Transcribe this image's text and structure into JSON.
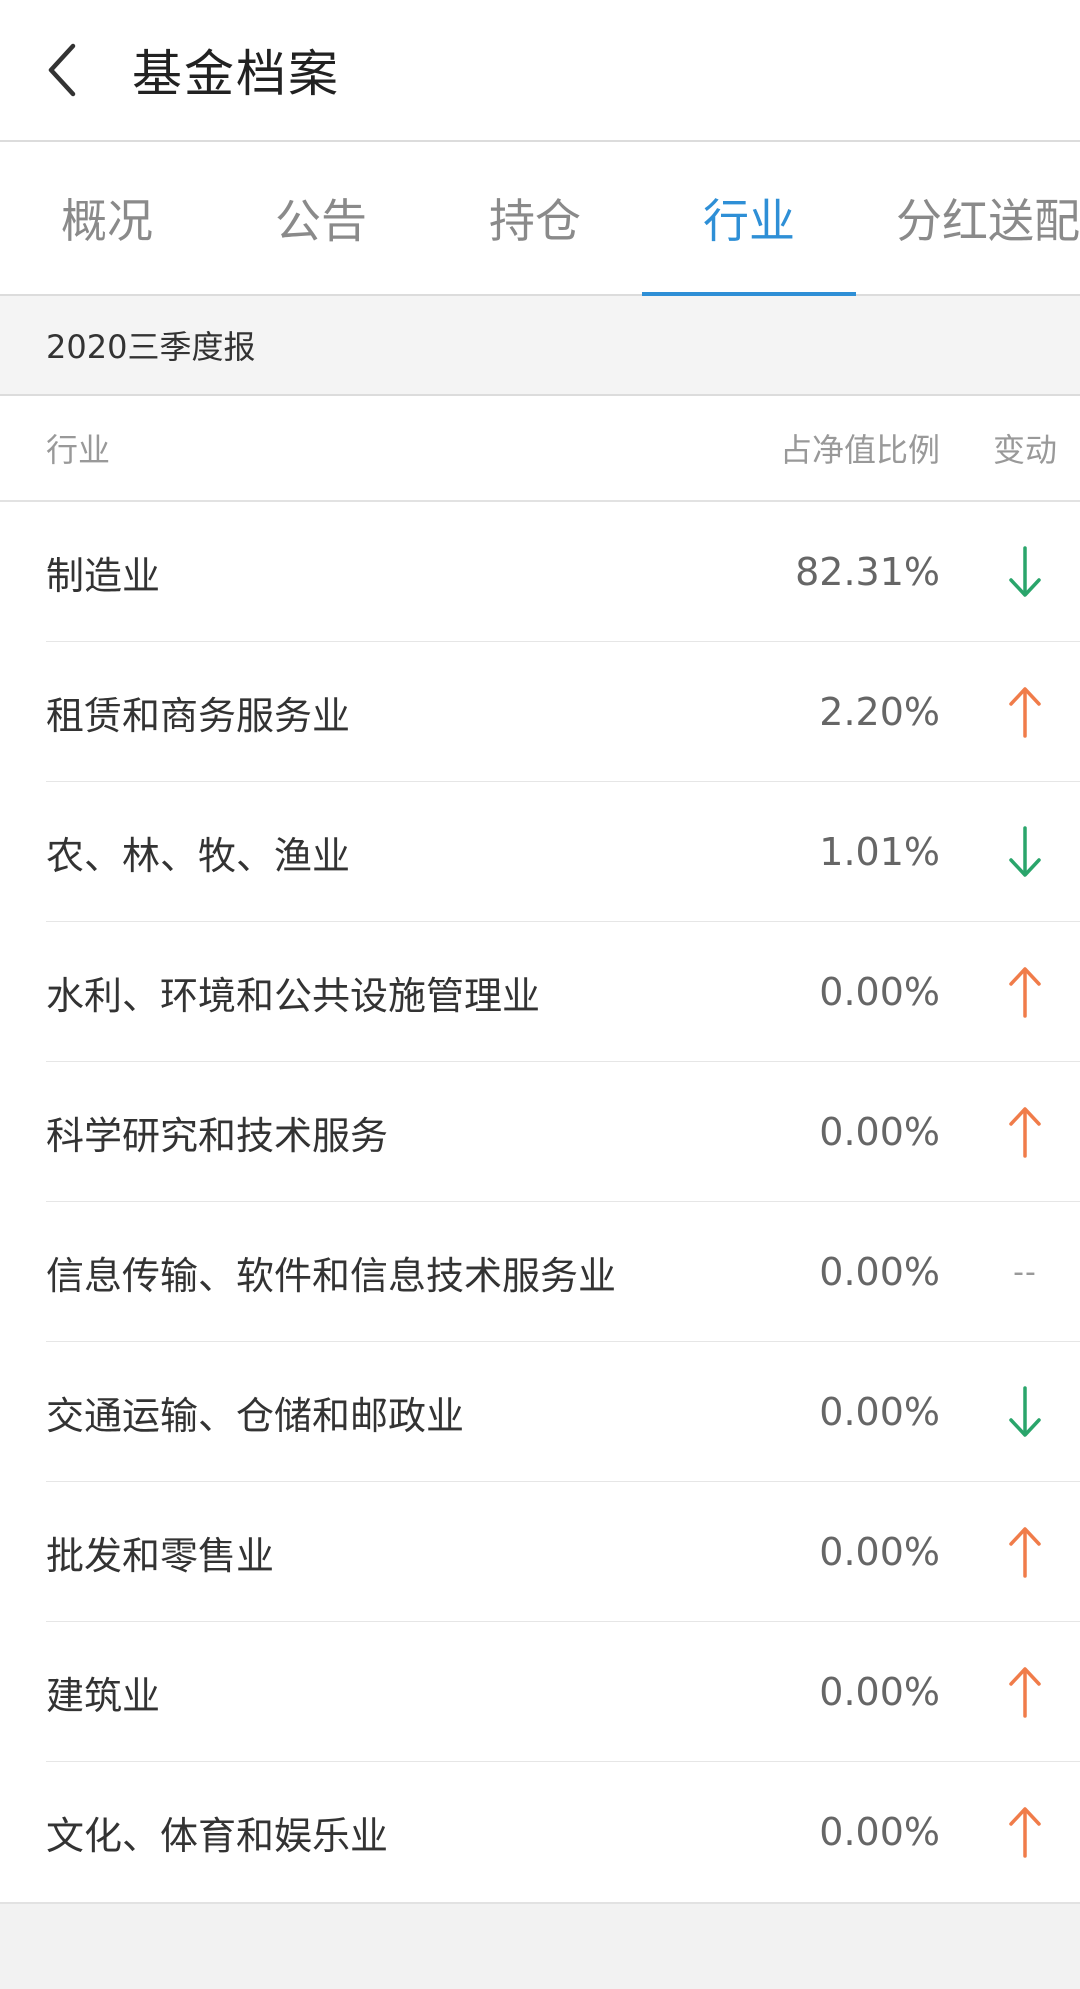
{
  "header": {
    "title": "基金档案",
    "back_icon": "chevron-left-icon"
  },
  "tabs": [
    {
      "label": "概况",
      "active": false
    },
    {
      "label": "公告",
      "active": false
    },
    {
      "label": "持仓",
      "active": false
    },
    {
      "label": "行业",
      "active": true
    },
    {
      "label": "分红送配",
      "active": false
    }
  ],
  "period": {
    "label": "2020三季度报"
  },
  "table": {
    "headers": {
      "industry": "行业",
      "ratio": "占净值比例",
      "change": "变动"
    },
    "rows": [
      {
        "industry": "制造业",
        "ratio": "82.31%",
        "change": "down"
      },
      {
        "industry": "租赁和商务服务业",
        "ratio": "2.20%",
        "change": "up"
      },
      {
        "industry": "农、林、牧、渔业",
        "ratio": "1.01%",
        "change": "down"
      },
      {
        "industry": "水利、环境和公共设施管理业",
        "ratio": "0.00%",
        "change": "up"
      },
      {
        "industry": "科学研究和技术服务",
        "ratio": "0.00%",
        "change": "up"
      },
      {
        "industry": "信息传输、软件和信息技术服务业",
        "ratio": "0.00%",
        "change": "none"
      },
      {
        "industry": "交通运输、仓储和邮政业",
        "ratio": "0.00%",
        "change": "down"
      },
      {
        "industry": "批发和零售业",
        "ratio": "0.00%",
        "change": "up"
      },
      {
        "industry": "建筑业",
        "ratio": "0.00%",
        "change": "up"
      },
      {
        "industry": "文化、体育和娱乐业",
        "ratio": "0.00%",
        "change": "up"
      }
    ],
    "no_change_text": "--"
  },
  "colors": {
    "accent": "#2e8fd6",
    "up": "#f07c4a",
    "down": "#2aa56b"
  }
}
